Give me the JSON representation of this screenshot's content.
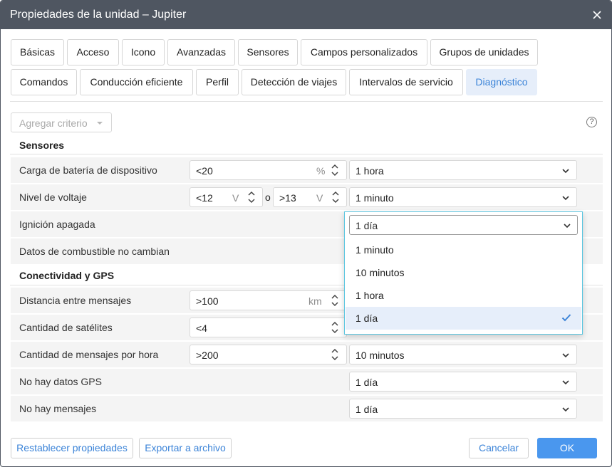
{
  "window": {
    "title": "Propiedades de la unidad – Jupiter"
  },
  "tabs": [
    {
      "label": "Básicas"
    },
    {
      "label": "Acceso"
    },
    {
      "label": "Icono"
    },
    {
      "label": "Avanzadas"
    },
    {
      "label": "Sensores"
    },
    {
      "label": "Campos personalizados"
    },
    {
      "label": "Grupos de unidades"
    },
    {
      "label": "Comandos"
    },
    {
      "label": "Conducción eficiente"
    },
    {
      "label": "Perfil"
    },
    {
      "label": "Detección de viajes"
    },
    {
      "label": "Intervalos de servicio"
    },
    {
      "label": "Diagnóstico",
      "active": true
    }
  ],
  "toolbar": {
    "add_criterion": "Agregar criterio",
    "help": "?"
  },
  "sections": {
    "sensors": "Sensores",
    "connectivity": "Conectividad y GPS"
  },
  "rows": {
    "battery": {
      "label": "Carga de batería de dispositivo",
      "value": "<20",
      "unit": "%",
      "interval": "1 hora"
    },
    "voltage": {
      "label": "Nivel de voltaje",
      "low": "<12",
      "low_unit": "V",
      "separator": "o",
      "high": ">13",
      "high_unit": "V",
      "interval": "1 minuto"
    },
    "ignition": {
      "label": "Ignición apagada",
      "interval": "1 día"
    },
    "fuel": {
      "label": "Datos de combustible no cambian"
    },
    "distance": {
      "label": "Distancia entre mensajes",
      "value": ">100",
      "unit": "km"
    },
    "satellites": {
      "label": "Cantidad de satélites",
      "value": "<4"
    },
    "messages_per_hour": {
      "label": "Cantidad de mensajes por hora",
      "value": ">200",
      "interval": "10 minutos"
    },
    "no_gps": {
      "label": "No hay datos GPS",
      "interval": "1 día"
    },
    "no_messages": {
      "label": "No hay mensajes",
      "interval": "1 día"
    }
  },
  "dropdown": {
    "selected": "1 día",
    "options": [
      "1 minuto",
      "10 minutos",
      "1 hora",
      "1 día"
    ]
  },
  "footer": {
    "reset": "Restablecer propiedades",
    "export": "Exportar a archivo",
    "cancel": "Cancelar",
    "ok": "OK"
  },
  "colors": {
    "titlebar": "#4f5661",
    "accent": "#3c84d8",
    "ok_button": "#4a97ee",
    "active_tab_bg": "#e6eefa",
    "dropdown_border": "#5bc6e0"
  },
  "icons": {
    "close": "close-icon",
    "help": "help-icon",
    "chevron": "chevron-down-icon",
    "spinner": "spinner-arrows-icon",
    "check": "check-icon"
  }
}
